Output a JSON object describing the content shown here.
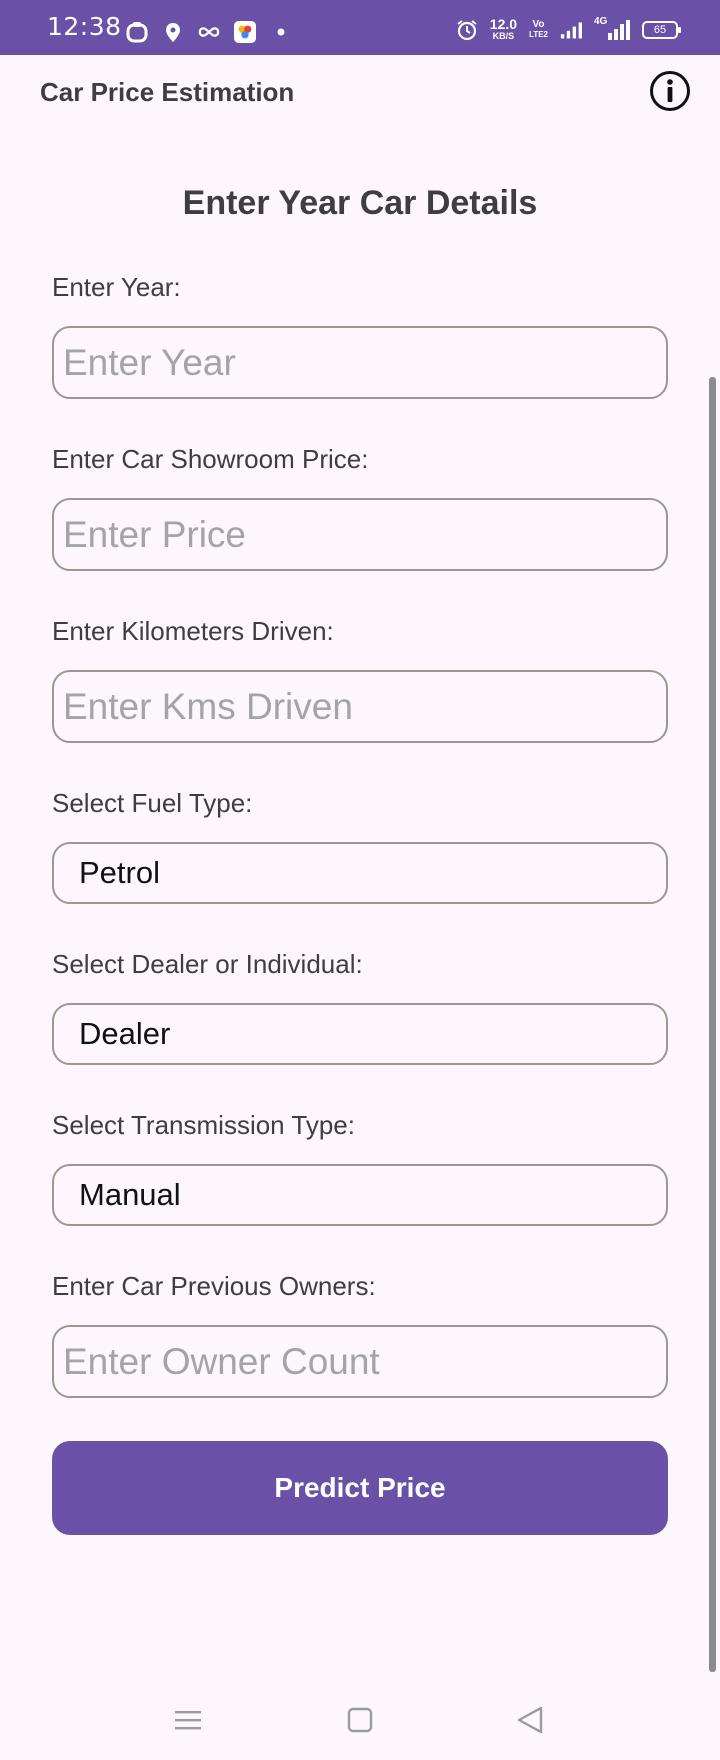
{
  "status_bar": {
    "time": "12:38",
    "net_speed_value": "12.0",
    "net_speed_unit": "KB/S",
    "volte_top": "Vo",
    "volte_bottom": "LTE2",
    "network_type": "4G",
    "battery": "65",
    "left_icons": [
      "notification-app-icon",
      "location-pin-icon",
      "infinity-icon",
      "photos-app-icon",
      "dot-icon"
    ],
    "right_icons": [
      "alarm-icon",
      "signal-icon",
      "signal-4g-icon",
      "battery-icon"
    ]
  },
  "app_bar": {
    "title": "Car Price Estimation",
    "action_icon": "info-icon"
  },
  "form": {
    "heading": "Enter Year Car Details",
    "year": {
      "label": "Enter Year:",
      "placeholder": "Enter Year",
      "value": ""
    },
    "price": {
      "label": "Enter Car Showroom Price:",
      "placeholder": "Enter Price",
      "value": ""
    },
    "kms": {
      "label": "Enter Kilometers Driven:",
      "placeholder": "Enter Kms Driven",
      "value": ""
    },
    "fuel": {
      "label": "Select Fuel Type:",
      "selected": "Petrol"
    },
    "seller": {
      "label": "Select Dealer or Individual:",
      "selected": "Dealer"
    },
    "transmission": {
      "label": "Select Transmission Type:",
      "selected": "Manual"
    },
    "owners": {
      "label": "Enter Car Previous Owners:",
      "placeholder": "Enter Owner Count",
      "value": ""
    },
    "submit_label": "Predict Price"
  },
  "nav_bar": {
    "icons": [
      "menu-icon",
      "home-icon",
      "back-icon"
    ]
  },
  "colors": {
    "primary": "#6a50a7",
    "background": "#fdf7fd",
    "text": "#3f3c44",
    "placeholder": "#a4a3a6",
    "border": "#9a9890"
  }
}
